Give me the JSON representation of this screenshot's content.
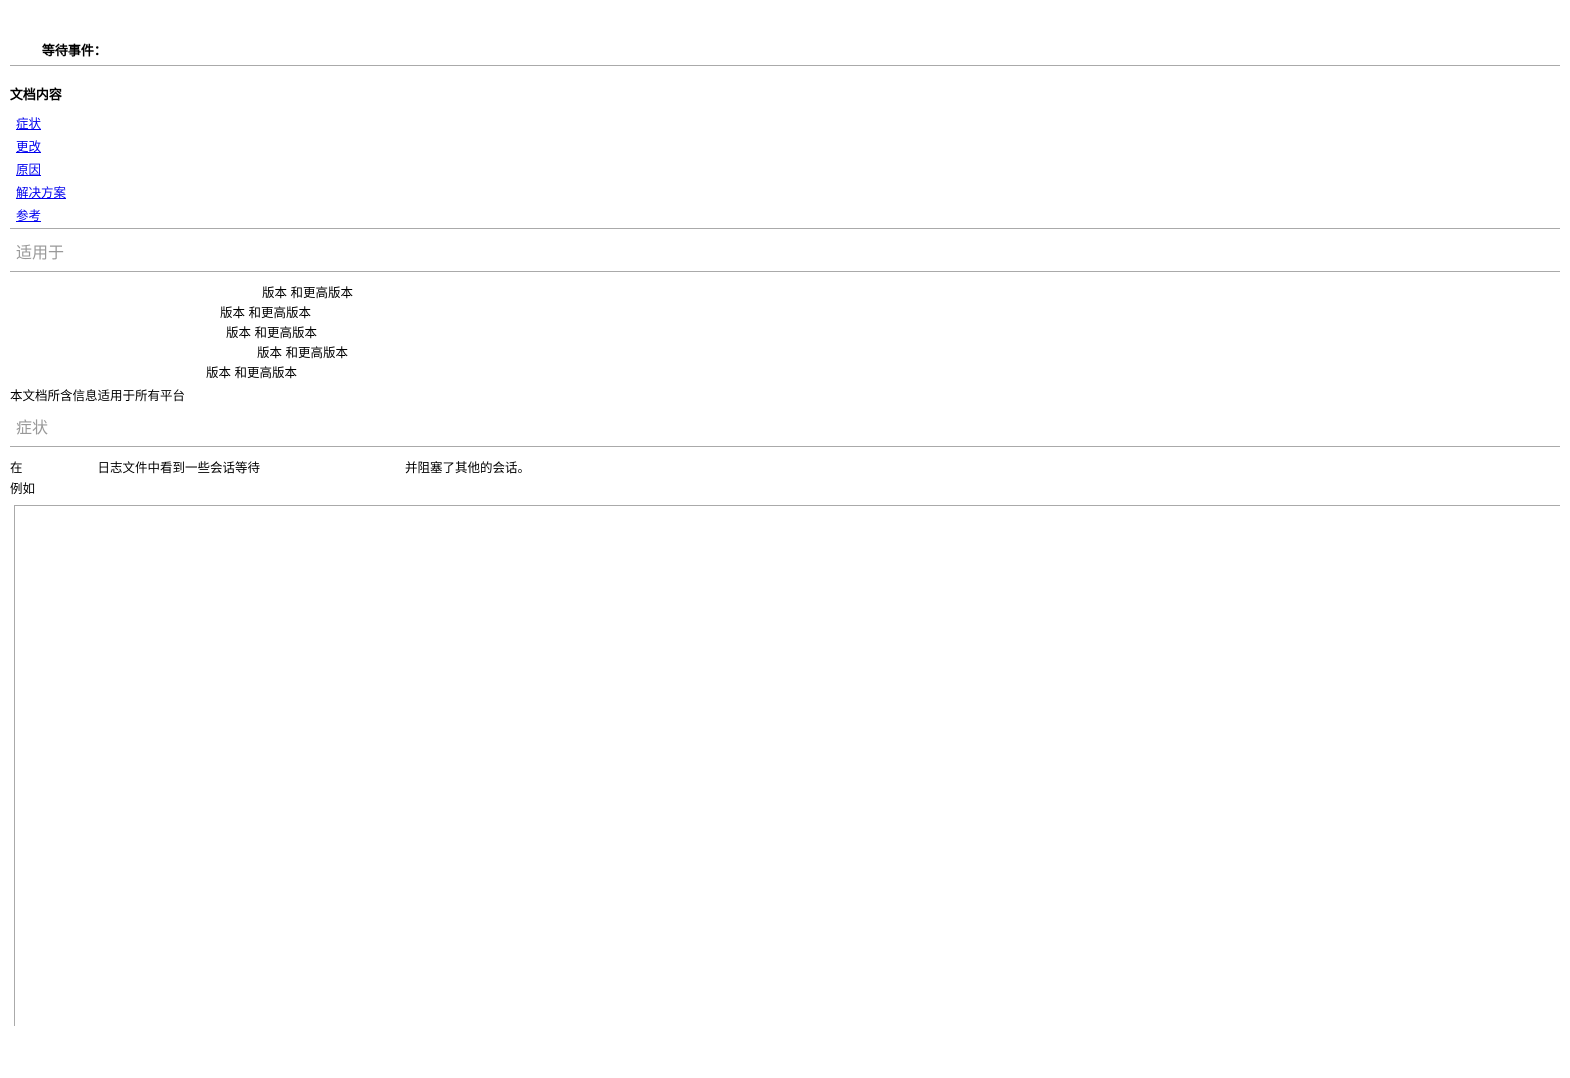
{
  "title": "等待事件：",
  "doc_content_heading": "文档内容",
  "toc": [
    {
      "label": "症状",
      "name": "toc-symptom"
    },
    {
      "label": "更改",
      "name": "toc-changes"
    },
    {
      "label": "原因",
      "name": "toc-cause"
    },
    {
      "label": "解决方案",
      "name": "toc-solution"
    },
    {
      "label": "参考",
      "name": "toc-reference"
    }
  ],
  "applies_to": {
    "heading": "适用于",
    "items": [
      "版本       和更高版本",
      "版本       和更高版本",
      "版本       和更高版本",
      "版本       和更高版本",
      "版本           和更高版本"
    ],
    "platform_note": "本文档所含信息适用于所有平台"
  },
  "symptom": {
    "heading": "症状",
    "text_prefix": "在",
    "text_middle": "日志文件中看到一些会话等待",
    "text_suffix": "并阻塞了其他的会话。",
    "example_label": "例如"
  }
}
